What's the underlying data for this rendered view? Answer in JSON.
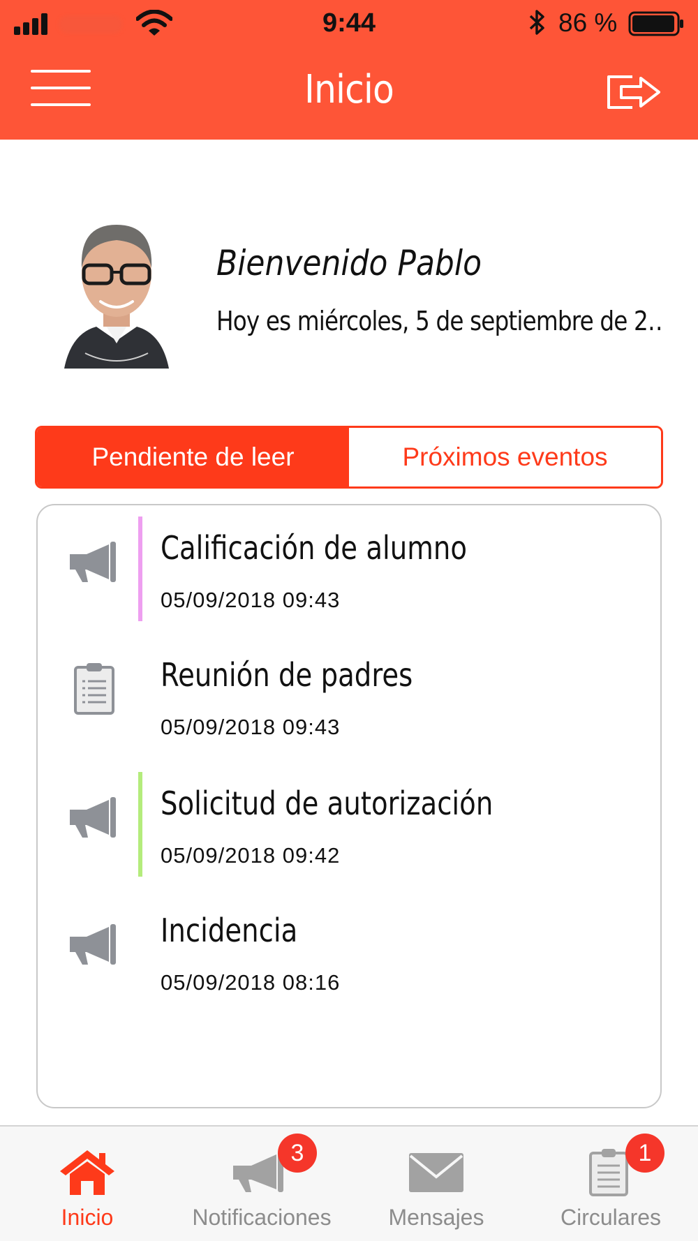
{
  "status_bar": {
    "time": "9:44",
    "battery_percent": "86 %"
  },
  "header": {
    "title": "Inicio",
    "menu_icon": "hamburger-icon",
    "logout_icon": "logout-icon"
  },
  "profile": {
    "welcome": "Bienvenido Pablo",
    "date_line": "Hoy es miércoles, 5 de septiembre de 2…"
  },
  "segments": [
    {
      "label": "Pendiente de leer",
      "selected": true
    },
    {
      "label": "Próximos eventos",
      "selected": false
    }
  ],
  "items": [
    {
      "title": "Calificación de alumno",
      "date": "05/09/2018 09:43",
      "icon": "megaphone-icon",
      "accent": "#ee9ff0"
    },
    {
      "title": "Reunión de padres",
      "date": "05/09/2018 09:43",
      "icon": "clipboard-icon",
      "accent": ""
    },
    {
      "title": "Solicitud de autorización",
      "date": "05/09/2018 09:42",
      "icon": "megaphone-icon",
      "accent": "#b4ec7c"
    },
    {
      "title": "Incidencia",
      "date": "05/09/2018 08:16",
      "icon": "megaphone-icon",
      "accent": ""
    }
  ],
  "tabs": [
    {
      "label": "Inicio",
      "icon": "home-icon",
      "active": true,
      "badge": ""
    },
    {
      "label": "Notificaciones",
      "icon": "megaphone-icon",
      "active": false,
      "badge": "3"
    },
    {
      "label": "Mensajes",
      "icon": "envelope-icon",
      "active": false,
      "badge": ""
    },
    {
      "label": "Circulares",
      "icon": "clipboard-icon",
      "active": false,
      "badge": "1"
    }
  ],
  "colors": {
    "brand": "#fe5537",
    "accent": "#fe3a1a",
    "icon_gray": "#8e9197",
    "badge": "#f5362a"
  }
}
